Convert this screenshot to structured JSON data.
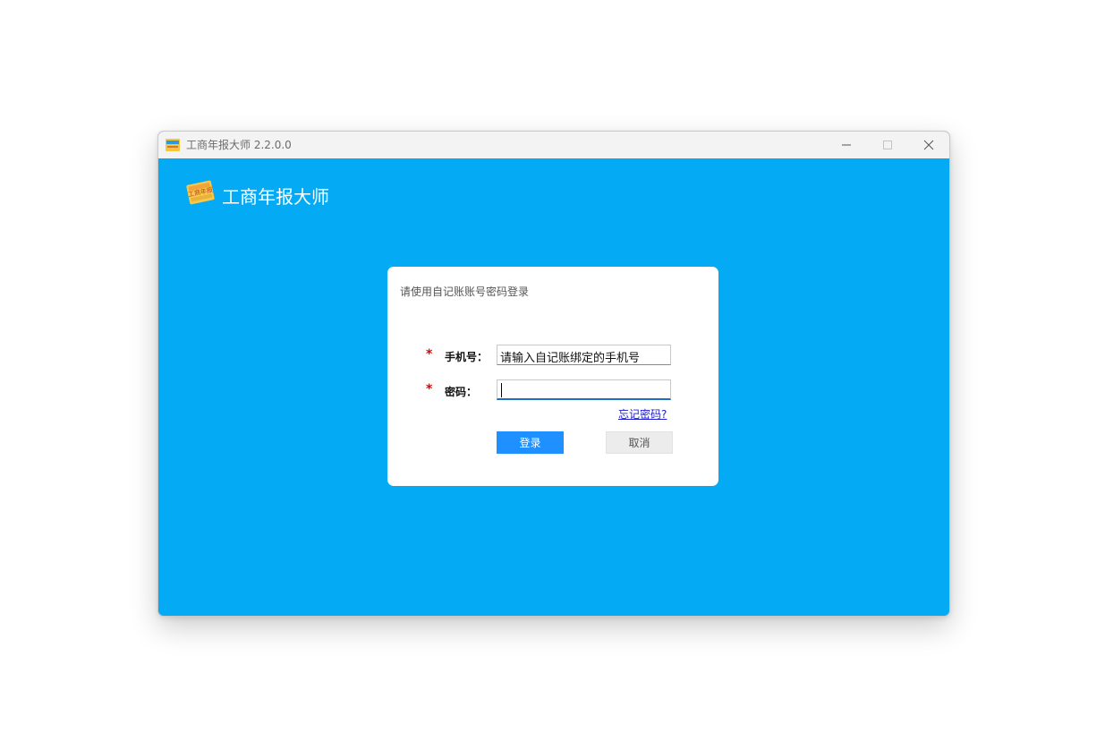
{
  "window": {
    "title": "工商年报大师 2.2.0.0",
    "icons": {
      "app": "app-logo-icon",
      "minimize": "minimize-icon",
      "maximize": "maximize-icon",
      "close": "close-icon"
    }
  },
  "brand": {
    "name": "工商年报大师",
    "logo_text": "工商年报"
  },
  "login": {
    "hint": "请使用自记账账号密码登录",
    "required_mark": "*",
    "phone_label": "手机号：",
    "phone_value": "请输入自记账绑定的手机号",
    "password_label": "密码：",
    "password_value": "",
    "forgot_link": "忘记密码?",
    "login_button": "登录",
    "cancel_button": "取消"
  },
  "colors": {
    "background": "#05aaf5",
    "primary_button": "#1e90ff",
    "required": "#e00000",
    "link": "#1c1cd6"
  }
}
